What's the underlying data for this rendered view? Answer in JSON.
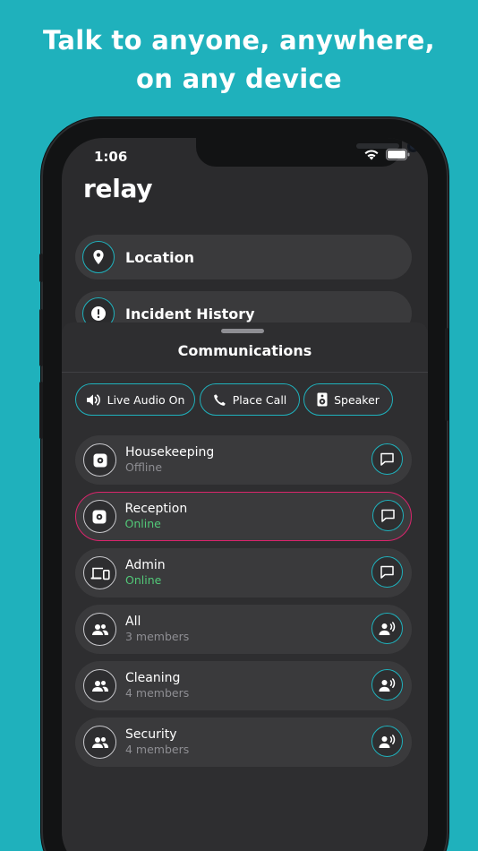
{
  "headline": {
    "line1": "Talk to anyone, anywhere,",
    "line2": "on any device"
  },
  "status_bar": {
    "time": "1:06",
    "icons": [
      "wifi-icon",
      "battery-icon"
    ]
  },
  "app": {
    "title": "relay"
  },
  "menu": [
    {
      "label": "Location",
      "icon": "location-pin-icon"
    },
    {
      "label": "Incident History",
      "icon": "alert-icon"
    }
  ],
  "sheet": {
    "title": "Communications",
    "chips": [
      {
        "label": "Live Audio On",
        "icon": "speaker-volume-icon"
      },
      {
        "label": "Place Call",
        "icon": "phone-icon"
      },
      {
        "label": "Speaker",
        "icon": "loudspeaker-icon"
      }
    ],
    "contacts": [
      {
        "name": "Housekeeping",
        "status": "Offline",
        "avatar": "relay-device-icon",
        "action": "message-icon",
        "selected": false,
        "online": false
      },
      {
        "name": "Reception",
        "status": "Online",
        "avatar": "relay-device-icon",
        "action": "message-icon",
        "selected": true,
        "online": true
      },
      {
        "name": "Admin",
        "status": "Online",
        "avatar": "devices-icon",
        "action": "message-icon",
        "selected": false,
        "online": true
      },
      {
        "name": "All",
        "status": "3 members",
        "avatar": "group-icon",
        "action": "group-voice-icon",
        "selected": false,
        "online": false
      },
      {
        "name": "Cleaning",
        "status": "4 members",
        "avatar": "group-icon",
        "action": "group-voice-icon",
        "selected": false,
        "online": false
      },
      {
        "name": "Security",
        "status": "4 members",
        "avatar": "group-icon",
        "action": "group-voice-icon",
        "selected": false,
        "online": false
      }
    ]
  },
  "colors": {
    "background": "#1fb1bc",
    "accent": "#1fb1bc",
    "selected_border": "#d9256c",
    "online": "#52c878",
    "muted": "#8e8e93"
  }
}
